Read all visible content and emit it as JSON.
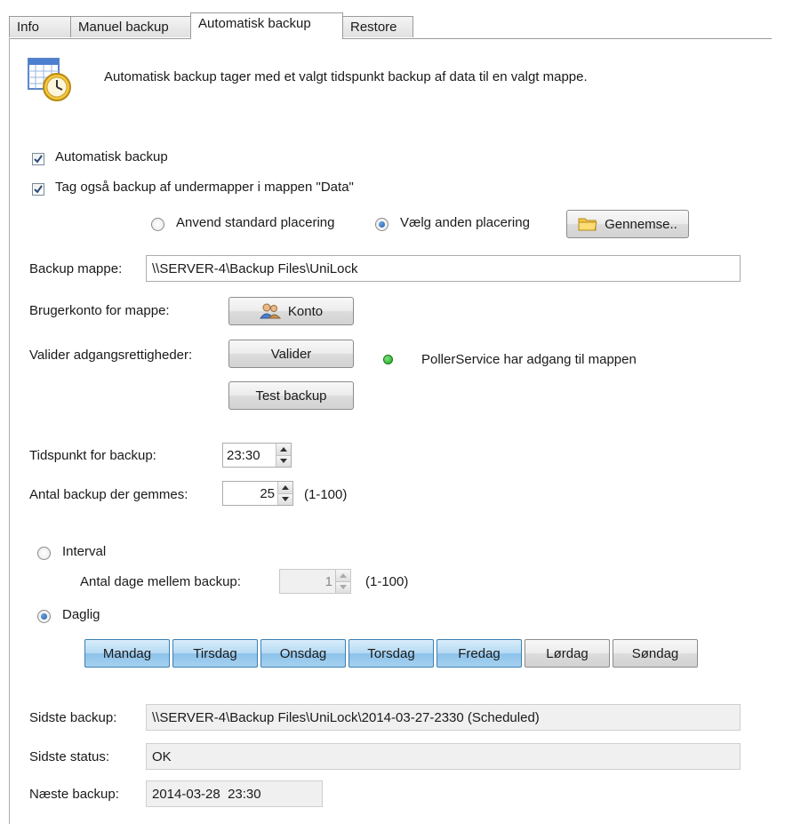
{
  "tabs": [
    "Info",
    "Manuel backup",
    "Automatisk backup",
    "Restore"
  ],
  "description": "Automatisk backup tager med et valgt tidspunkt backup af data til en valgt mappe.",
  "options": {
    "auto_backup": "Automatisk backup",
    "include_subfolders": "Tag også backup af undermapper i mappen \"Data\"",
    "use_default_location": "Anvend standard placering",
    "choose_other_location": "Vælg anden placering",
    "browse": "Gennemse.."
  },
  "folder": {
    "label": "Backup mappe:",
    "value": "\\\\SERVER-4\\Backup Files\\UniLock"
  },
  "account": {
    "label": "Brugerkonto for mappe:",
    "button": "Konto"
  },
  "validate": {
    "label": "Valider adgangsrettigheder:",
    "button": "Valider",
    "status": "PollerService har adgang til mappen",
    "status_color": "#1fa81f",
    "test_button": "Test backup"
  },
  "schedule": {
    "time_label": "Tidspunkt for backup:",
    "time_value": "23:30",
    "count_label": "Antal backup der gemmes:",
    "count_value": "25",
    "count_range": "(1-100)"
  },
  "frequency": {
    "interval_label": "Interval",
    "days_between_label": "Antal dage mellem backup:",
    "days_between_value": "1",
    "days_between_range": "(1-100)",
    "daily_label": "Daglig",
    "days": [
      {
        "label": "Mandag",
        "selected": true
      },
      {
        "label": "Tirsdag",
        "selected": true
      },
      {
        "label": "Onsdag",
        "selected": true
      },
      {
        "label": "Torsdag",
        "selected": true
      },
      {
        "label": "Fredag",
        "selected": true
      },
      {
        "label": "Lørdag",
        "selected": false
      },
      {
        "label": "Søndag",
        "selected": false
      }
    ]
  },
  "status": {
    "last_backup_label": "Sidste backup:",
    "last_backup_value": "\\\\SERVER-4\\Backup Files\\UniLock\\2014-03-27-2330 (Scheduled)",
    "last_status_label": "Sidste status:",
    "last_status_value": "OK",
    "next_backup_label": "Næste backup:",
    "next_backup_value": "2014-03-28  23:30"
  },
  "colors": {
    "day_selected": "#a6d1ef",
    "day_unselected": "#e4e4e4"
  }
}
